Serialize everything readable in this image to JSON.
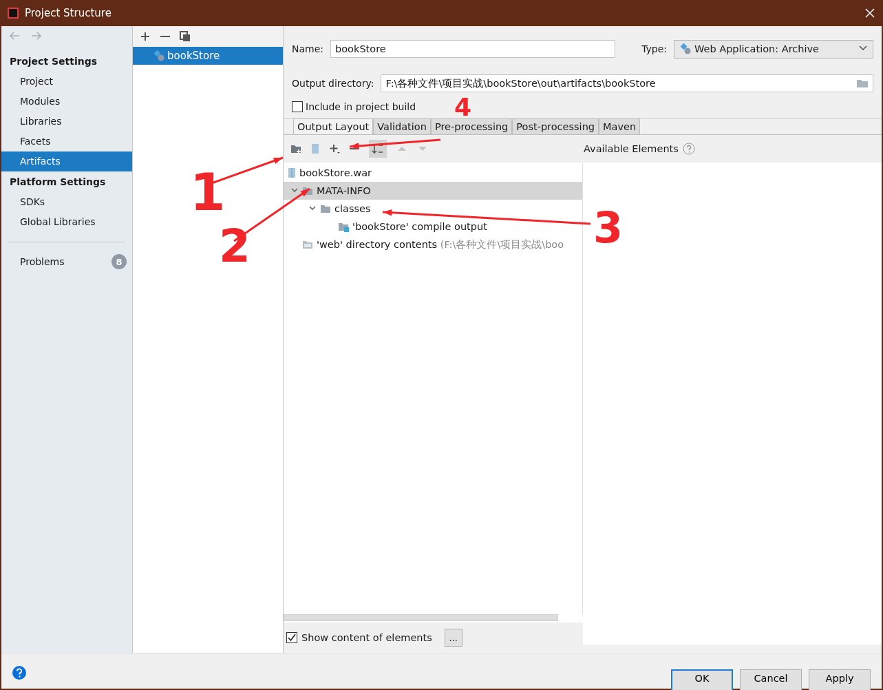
{
  "window": {
    "title": "Project Structure"
  },
  "sidebar": {
    "sections": [
      {
        "title": "Project Settings",
        "items": [
          {
            "label": "Project",
            "selected": false
          },
          {
            "label": "Modules",
            "selected": false
          },
          {
            "label": "Libraries",
            "selected": false
          },
          {
            "label": "Facets",
            "selected": false
          },
          {
            "label": "Artifacts",
            "selected": true
          }
        ]
      },
      {
        "title": "Platform Settings",
        "items": [
          {
            "label": "SDKs",
            "selected": false
          },
          {
            "label": "Global Libraries",
            "selected": false
          }
        ]
      }
    ],
    "problems": {
      "label": "Problems",
      "count": "8"
    }
  },
  "artifacts": [
    {
      "label": "bookStore",
      "selected": true
    }
  ],
  "form": {
    "name_label": "Name:",
    "name_value": "bookStore",
    "type_label": "Type:",
    "type_value": "Web Application: Archive",
    "output_label": "Output directory:",
    "output_value": "F:\\各种文件\\项目实战\\bookStore\\out\\artifacts\\bookStore",
    "include_label": "Include in project build",
    "include_checked": false
  },
  "tabs": [
    {
      "label": "Output Layout",
      "selected": true
    },
    {
      "label": "Validation",
      "selected": false
    },
    {
      "label": "Pre-processing",
      "selected": false
    },
    {
      "label": "Post-processing",
      "selected": false
    },
    {
      "label": "Maven",
      "selected": false
    }
  ],
  "available_title": "Available Elements",
  "tree": [
    {
      "label": "bookStore.war",
      "kind": "archive",
      "selected": false,
      "children": [
        {
          "label": "MATA-INFO",
          "kind": "folder",
          "selected": true,
          "expanded": true,
          "children": [
            {
              "label": "classes",
              "kind": "folder",
              "selected": false,
              "expanded": true,
              "children": [
                {
                  "label": "'bookStore' compile output",
                  "kind": "output",
                  "selected": false
                }
              ]
            }
          ]
        },
        {
          "label": "'web' directory contents",
          "hint": "(F:\\各种文件\\项目实战\\boo",
          "kind": "webdir",
          "selected": false
        }
      ]
    }
  ],
  "show_content": {
    "label": "Show content of elements",
    "checked": true,
    "button": "..."
  },
  "buttons": [
    {
      "label": "OK",
      "default": true
    },
    {
      "label": "Cancel",
      "default": false
    },
    {
      "label": "Apply",
      "default": false
    }
  ],
  "annotations": [
    {
      "label": "1"
    },
    {
      "label": "2"
    },
    {
      "label": "3"
    },
    {
      "label": "4"
    }
  ]
}
